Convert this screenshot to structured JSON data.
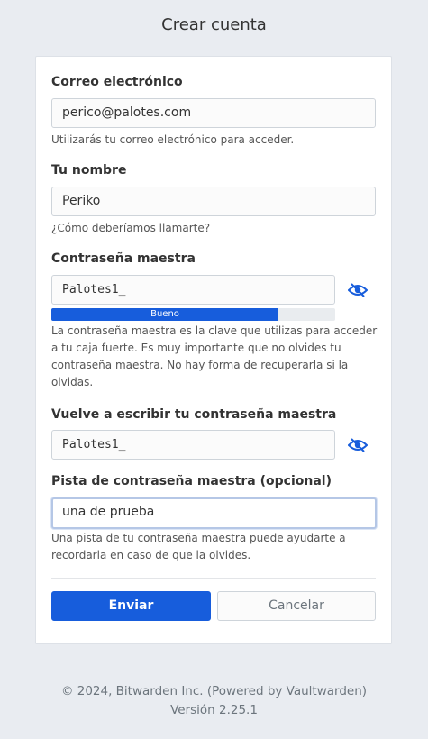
{
  "header": {
    "title": "Crear cuenta"
  },
  "form": {
    "email": {
      "label": "Correo electrónico",
      "value": "perico@palotes.com",
      "help": "Utilizarás tu correo electrónico para acceder."
    },
    "name": {
      "label": "Tu nombre",
      "value": "Periko",
      "help": "¿Cómo deberíamos llamarte?"
    },
    "master_password": {
      "label": "Contraseña maestra",
      "value": "Palotes1_",
      "strength_label": "Bueno",
      "strength_fraction": 0.8,
      "help": "La contraseña maestra es la clave que utilizas para acceder a tu caja fuerte. Es muy importante que no olvides tu contraseña maestra. No hay forma de recuperarla si la olvidas."
    },
    "retype_password": {
      "label": "Vuelve a escribir tu contraseña maestra",
      "value": "Palotes1_"
    },
    "hint": {
      "label": "Pista de contraseña maestra (opcional)",
      "value": "una de prueba",
      "help": "Una pista de tu contraseña maestra puede ayudarte a recordarla en caso de que la olvides."
    },
    "submit_label": "Enviar",
    "cancel_label": "Cancelar"
  },
  "footer": {
    "copyright": "© 2024, Bitwarden Inc. (Powered by Vaultwarden)",
    "version": "Versión 2.25.1"
  },
  "colors": {
    "accent": "#175ddc",
    "background": "#e9ecf1"
  },
  "icons": {
    "toggle_visibility": "eye-slash-icon"
  }
}
